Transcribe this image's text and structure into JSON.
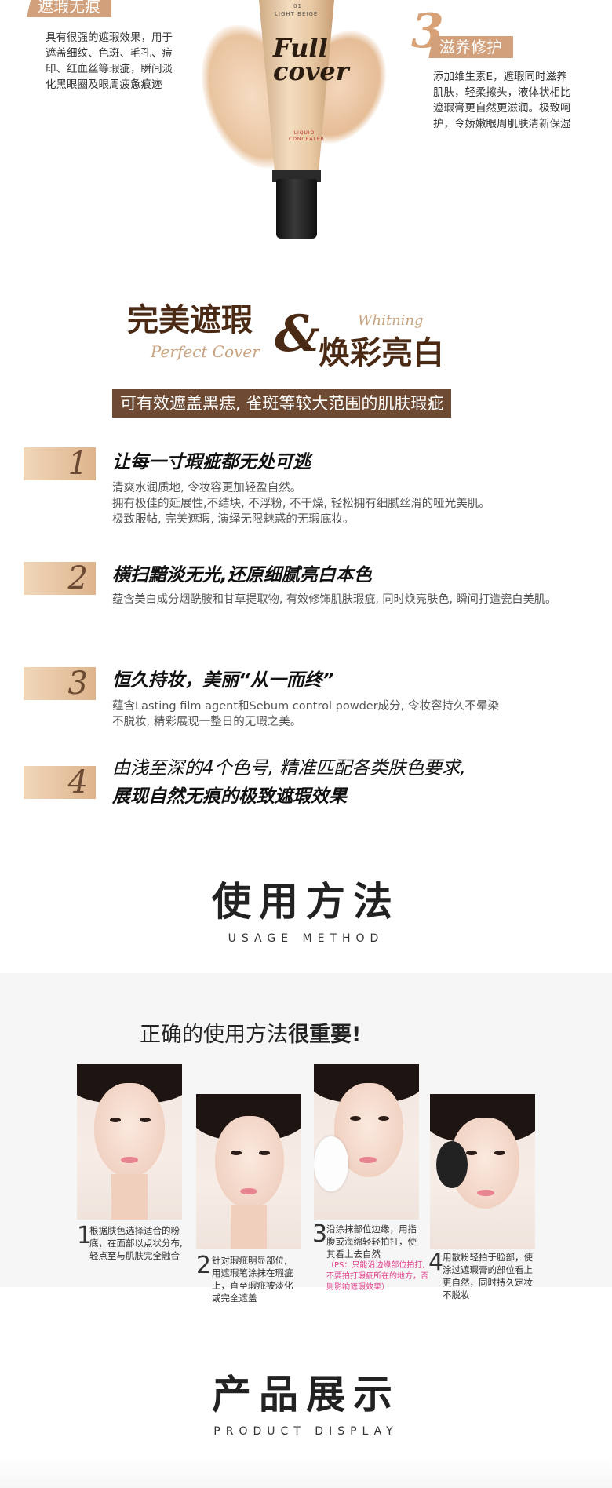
{
  "features": {
    "f1": {
      "tag": "遮瑕无痕",
      "text": [
        "具有很强的遮瑕效果，用于",
        "遮盖细纹、色斑、毛孔、痘",
        "印、红血丝等瑕疵，瞬间淡",
        "化黑眼圈及眼周疲惫痕迹"
      ]
    },
    "f3": {
      "number": "3",
      "tag": "滋养修护",
      "text": [
        "添加维生素E，遮瑕同时滋养",
        "肌肤，轻柔擦头，液体状相比",
        "遮瑕膏更自然更滋润。极致呵",
        "护，令娇嫩眼周肌肤清新保湿"
      ]
    }
  },
  "tube": {
    "brand": "Full cover",
    "shade_code": "01",
    "shade_name": "LIGHT BEIGE",
    "product_type": "LIQUID CONCEALER"
  },
  "perfect": {
    "title_left": "完美遮瑕",
    "script_left": "Perfect Cover",
    "amp": "&",
    "script_right": "Whitning",
    "title_right": "焕彩亮白",
    "bar": "可有效遮盖黑痣, 雀斑等较大范围的肌肤瑕疵"
  },
  "points": [
    {
      "num": "1",
      "title": "让每一寸瑕疵都无处可逃",
      "desc": [
        "清爽水润质地, 令妆容更加轻盈自然。",
        "拥有极佳的延展性,不结块, 不浮粉, 不干燥, 轻松拥有细腻丝滑的哑光美肌。",
        "极致服帖, 完美遮瑕, 演绎无限魅惑的无瑕底妆。"
      ]
    },
    {
      "num": "2",
      "title": "横扫黯淡无光,还原细腻亮白本色",
      "desc": [
        "蕴含美白成分烟酰胺和甘草提取物, 有效修饰肌肤瑕疵, 同时焕亮肤色, 瞬间打造瓷白美肌。"
      ]
    },
    {
      "num": "3",
      "title": "恒久持妆，美丽“从一而终”",
      "desc": [
        "蕴含Lasting film agent和Sebum  control  powder成分, 令妆容持久不晕染",
        "不脱妆, 精彩展现一整日的无瑕之美。"
      ]
    },
    {
      "num": "4",
      "title_lines": [
        "由浅至深的4个色号, 精准匹配各类肤色要求,",
        "展现自然无痕的极致遮瑕效果"
      ]
    }
  ],
  "usage": {
    "title": "使用方法",
    "subtitle": "USAGE METHOD",
    "heading_normal": "正确的使用方法",
    "heading_bold": "很重要!",
    "steps": [
      {
        "num": "1",
        "lines": [
          "根据肤色选择适合的粉",
          "底，在面部以点状分布,",
          "轻点至与肌肤完全融合"
        ]
      },
      {
        "num": "2",
        "lines": [
          "针对瑕疵明显部位,",
          "用遮瑕笔涂抹在瑕疵",
          "上，直至瑕疵被淡化",
          "或完全遮盖"
        ]
      },
      {
        "num": "3",
        "lines": [
          "沿涂抹部位边缘，用指",
          "腹或海绵轻轻拍打，使",
          "其看上去自然"
        ],
        "note": [
          "（PS：只能沿边缘部位拍打,",
          "不要拍打瑕疵所在的地方，否",
          "则影响遮瑕效果）"
        ]
      },
      {
        "num": "4",
        "lines": [
          "用散粉轻拍于脸部，使",
          "涂过遮瑕膏的部位看上",
          "更自然，同时持久定妆",
          "不脱妆"
        ]
      }
    ]
  },
  "display": {
    "title": "产品展示",
    "subtitle": "PRODUCT DISPLAY"
  },
  "colors": {
    "tan": "#d2a07a",
    "brown": "#6e4a33",
    "dark_brown": "#4a2a14",
    "note_pink": "#e03c8a"
  }
}
